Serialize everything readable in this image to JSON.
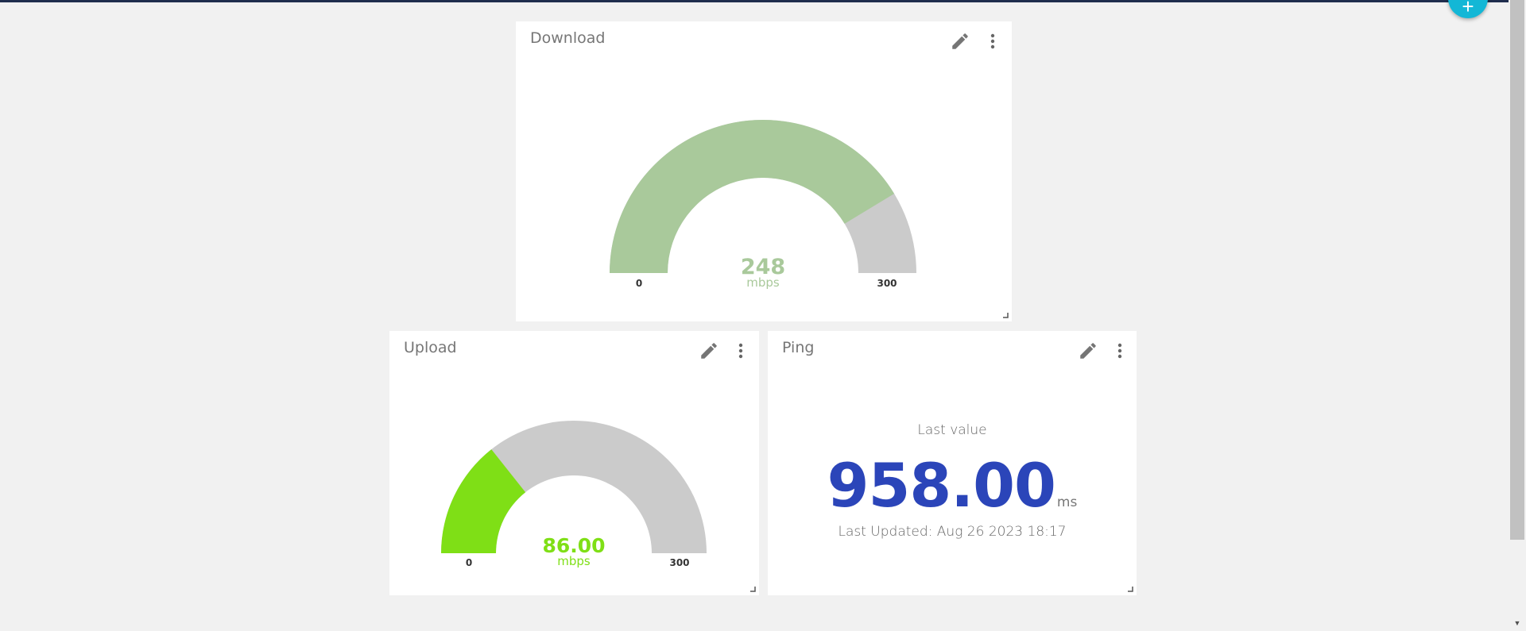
{
  "colors": {
    "download_fill": "#a9c99b",
    "upload_fill": "#7fdf16",
    "gauge_track": "#cbcbcb",
    "ping_value": "#2b45b9",
    "fab": "#13b7d6"
  },
  "fab": {
    "icon": "plus-icon",
    "label": "+"
  },
  "widgets": {
    "download": {
      "title": "Download",
      "value": "248",
      "value_num": 248,
      "unit": "mbps",
      "min": "0",
      "max": "300",
      "min_num": 0,
      "max_num": 300
    },
    "upload": {
      "title": "Upload",
      "value": "86.00",
      "value_num": 86,
      "unit": "mbps",
      "min": "0",
      "max": "300",
      "min_num": 0,
      "max_num": 300
    },
    "ping": {
      "title": "Ping",
      "label": "Last value",
      "value": "958.00",
      "unit": "ms",
      "updated": "Last Updated: Aug 26 2023 18:17"
    }
  }
}
